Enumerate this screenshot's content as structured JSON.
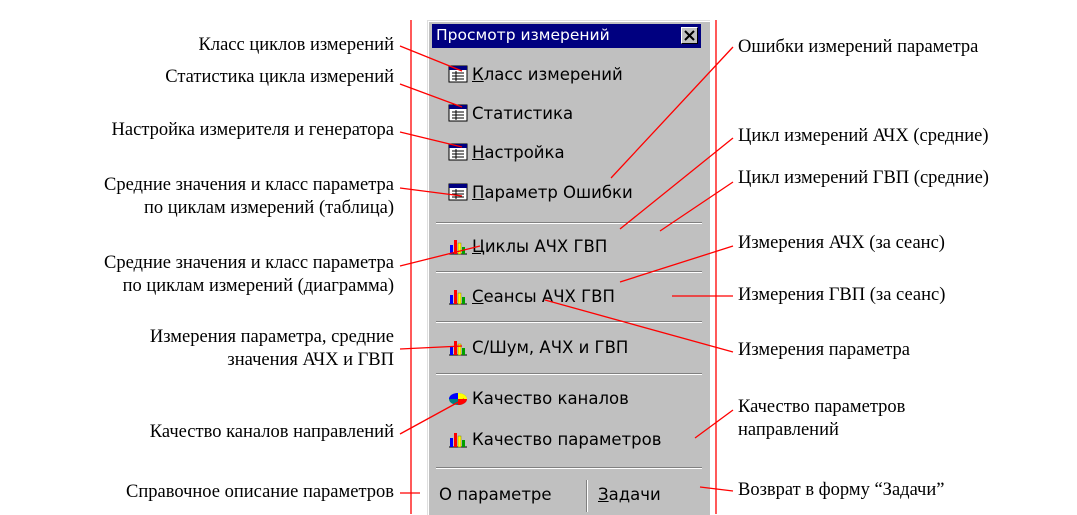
{
  "panel": {
    "title": "Просмотр измерений",
    "items": [
      {
        "prefix": "",
        "accel": "К",
        "rest": "ласс измерений"
      },
      {
        "prefix": "",
        "accel": "С",
        "rest": "татистика"
      },
      {
        "prefix": "",
        "accel": "Н",
        "rest": "астройка"
      },
      {
        "prefix": "",
        "accel": "П",
        "rest": "араметр  Ошибки"
      },
      {
        "prefix": "",
        "accel": "Ц",
        "rest": "иклы  АЧХ  ГВП"
      },
      {
        "prefix": "",
        "accel": "С",
        "rest": "еансы  АЧХ  ГВП"
      },
      {
        "prefix": "",
        "accel": "",
        "rest": "С/Шум, АЧХ и ГВП"
      },
      {
        "prefix": "",
        "accel": "",
        "rest": "Качество каналов"
      },
      {
        "prefix": "",
        "accel": "",
        "rest": "Качество параметров"
      }
    ],
    "bottom": {
      "left_button": "О параметре",
      "right_accel": "З",
      "right_rest": "адачи"
    }
  },
  "annotations_left": [
    {
      "lines": [
        "Класс циклов измерений"
      ]
    },
    {
      "lines": [
        "Статистика цикла измерений"
      ]
    },
    {
      "lines": [
        "Настройка измерителя и генератора"
      ]
    },
    {
      "lines": [
        "Средние значения и класс параметра",
        "по циклам измерений (таблица)"
      ]
    },
    {
      "lines": [
        "Средние значения и класс параметра",
        "по циклам измерений (диаграмма)"
      ]
    },
    {
      "lines": [
        "Измерения параметра, средние",
        "значения АЧХ и ГВП"
      ]
    },
    {
      "lines": [
        "Качество каналов направлений"
      ]
    },
    {
      "lines": [
        "Справочное описание параметров"
      ]
    }
  ],
  "annotations_right": [
    {
      "lines": [
        "Ошибки измерений параметра"
      ]
    },
    {
      "lines": [
        "Цикл измерений АЧХ (средние)"
      ]
    },
    {
      "lines": [
        "Цикл измерений ГВП (средние)"
      ]
    },
    {
      "lines": [
        "Измерения АЧХ  (за сеанс)"
      ]
    },
    {
      "lines": [
        "Измерения ГВП  (за сеанс)"
      ]
    },
    {
      "lines": [
        "Измерения параметра"
      ]
    },
    {
      "lines": [
        "Качество параметров",
        "направлений"
      ]
    },
    {
      "lines": [
        "Возврат в форму “Задачи”"
      ]
    }
  ],
  "colors": {
    "panel": "#c0c0c0",
    "titlebar": "#000080",
    "leader_line": "#ff0000"
  }
}
